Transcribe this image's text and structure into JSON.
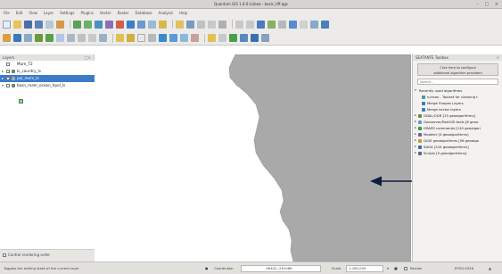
{
  "window": {
    "title": "Quantum GIS 1.8.0-Lisboa - basic_tiff.qgs"
  },
  "menubar": [
    "File",
    "Edit",
    "View",
    "Layer",
    "Settings",
    "Plugins",
    "Vector",
    "Raster",
    "Database",
    "Analysis",
    "Help"
  ],
  "layers_panel": {
    "title": "Layers",
    "items": [
      {
        "name": "Mum_T2",
        "checked": false,
        "selected": false,
        "indent": 0
      },
      {
        "name": "ls_country_ls",
        "checked": true,
        "selected": false,
        "indent": 0
      },
      {
        "name": "pol_mem_ls",
        "checked": true,
        "selected": true,
        "indent": 0
      },
      {
        "name": "basn_mam_ocean_hpol_ls",
        "checked": false,
        "selected": false,
        "indent": 0
      }
    ],
    "control_rendering_label": "Control rendering order"
  },
  "toolbox": {
    "title": "SEXTANTE Toolbox",
    "config_button_line1": "Click here to configure",
    "config_button_line2": "additional algorithm providers",
    "search_placeholder": "Search...",
    "tree": [
      {
        "label": "Recently used algorithms",
        "level": 0,
        "expanded": true,
        "color": ""
      },
      {
        "label": "v.clean - Toolset for cleaning t",
        "level": 1,
        "expanded": false,
        "color": "#3aa0a8"
      },
      {
        "label": "Merge Shapes Layers",
        "level": 1,
        "expanded": false,
        "color": "#3a7ab8"
      },
      {
        "label": "Merge vector layers",
        "level": 1,
        "expanded": false,
        "color": "#3a7ab8"
      },
      {
        "label": "GDAL/OGR [15 geoalgorithms]",
        "level": 0,
        "expanded": false,
        "color": "#6a8a4a"
      },
      {
        "label": "Geoserver/PostGIS tools [8 geoa",
        "level": 0,
        "expanded": false,
        "color": "#6a9aba"
      },
      {
        "label": "GRASS commands [140 geoalgori",
        "level": 0,
        "expanded": false,
        "color": "#3a9a4a"
      },
      {
        "label": "Modeler [0 geoalgorithms]",
        "level": 0,
        "expanded": false,
        "color": "#7a5a9a"
      },
      {
        "label": "QGIS geoalgorithms [56 geoalgo",
        "level": 0,
        "expanded": false,
        "color": "#c89a2a"
      },
      {
        "label": "SAGA [244 geoalgorithms]",
        "level": 0,
        "expanded": false,
        "color": "#3a6ab8"
      },
      {
        "label": "Scripts [5 geoalgorithms]",
        "level": 0,
        "expanded": false,
        "color": "#5a6a7a"
      }
    ]
  },
  "statusbar": {
    "hint": "Toggles the editing state of the current layer",
    "coordinate_label": "Coordinate:",
    "coordinate_value": "-58402,-261086",
    "scale_label": "Scale",
    "scale_value": "1:180,000",
    "render_label": "Render",
    "epsg": "EPSG:4326"
  },
  "colors": {
    "land_fill": "#a9a9a9",
    "selection": "#3b7bc8",
    "arrow": "#0d1f3c"
  }
}
